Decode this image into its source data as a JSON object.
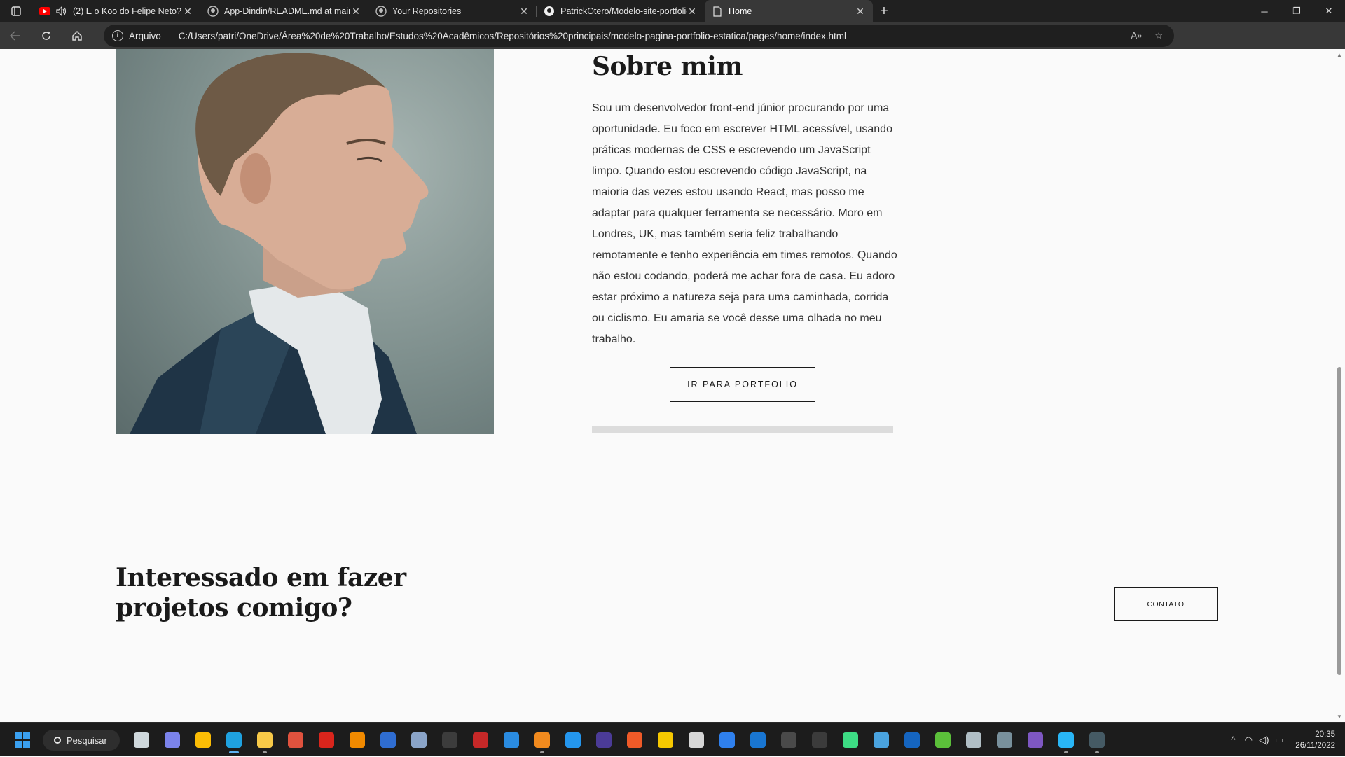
{
  "browser": {
    "tabs": [
      {
        "title": "(2) E o Koo do Felipe Neto?",
        "icon": "youtube-icon",
        "audio": true,
        "active": false
      },
      {
        "title": "App-Dindin/README.md at main",
        "icon": "github-icon",
        "audio": false,
        "active": false
      },
      {
        "title": "Your Repositories",
        "icon": "github-icon",
        "audio": false,
        "active": false
      },
      {
        "title": "PatrickOtero/Modelo-site-portfolio",
        "icon": "github-icon",
        "audio": false,
        "active": false
      },
      {
        "title": "Home",
        "icon": "document-icon",
        "audio": false,
        "active": true
      }
    ],
    "address": {
      "scheme_label": "Arquivo",
      "url": "C:/Users/patri/OneDrive/Área%20de%20Trabalho/Estudos%20Acadêmicos/Repositórios%20principais/modelo-pagina-portfolio-estatica/pages/home/index.html"
    }
  },
  "page": {
    "about": {
      "heading": "Sobre mim",
      "body": "Sou um desenvolvedor front-end júnior procurando por uma oportunidade. Eu foco em escrever HTML acessível, usando práticas modernas de CSS e escrevendo um JavaScript limpo. Quando estou escrevendo código JavaScript, na maioria das vezes estou usando React, mas posso me adaptar para qualquer ferramenta se necessário. Moro em Londres, UK, mas também seria feliz trabalhando remotamente e tenho experiência em times remotos. Quando não estou codando, poderá me achar fora de casa. Eu adoro estar próximo a natureza seja para uma caminhada, corrida ou ciclismo. Eu amaria se você desse uma olhada no meu trabalho.",
      "button_label": "IR PARA PORTFOLIO"
    },
    "cta": {
      "heading": "Interessado em fazer projetos comigo?",
      "button_label": "CONTATO"
    }
  },
  "taskbar": {
    "search_label": "Pesquisar",
    "apps": [
      {
        "name": "task-view-icon",
        "color": "#cfd8dc",
        "running": false
      },
      {
        "name": "meet-icon",
        "color": "#7b83eb",
        "running": false
      },
      {
        "name": "chrome-icon",
        "color": "#fbbc05",
        "running": false
      },
      {
        "name": "edge-icon",
        "color": "#1fa2e0",
        "running": true,
        "active": true
      },
      {
        "name": "file-explorer-icon",
        "color": "#f7c948",
        "running": true
      },
      {
        "name": "creative-cloud-icon",
        "color": "#e0523e",
        "running": false
      },
      {
        "name": "acrobat-icon",
        "color": "#d9251c",
        "running": false
      },
      {
        "name": "vlc-icon",
        "color": "#f18a00",
        "running": false
      },
      {
        "name": "bitwarden-icon",
        "color": "#2f6dd1",
        "running": false
      },
      {
        "name": "notepad-icon",
        "color": "#8aa4c8",
        "running": false
      },
      {
        "name": "terminal-icon",
        "color": "#3c3c3c",
        "running": false
      },
      {
        "name": "devcpp-icon",
        "color": "#c62828",
        "running": false
      },
      {
        "name": "vscode-icon",
        "color": "#2a8be0",
        "running": false
      },
      {
        "name": "sublime-icon",
        "color": "#f18a1e",
        "running": true
      },
      {
        "name": "docker-icon",
        "color": "#2496ed",
        "running": false
      },
      {
        "name": "eclipse-icon",
        "color": "#4b3b97",
        "running": false
      },
      {
        "name": "bookmark-app-icon",
        "color": "#f05a28",
        "running": false
      },
      {
        "name": "beekeeper-icon",
        "color": "#f6c800",
        "running": false
      },
      {
        "name": "search-app-icon",
        "color": "#d6d6d6",
        "running": false
      },
      {
        "name": "browser-app-icon",
        "color": "#2f80ed",
        "running": false
      },
      {
        "name": "insomnia-icon",
        "color": "#1976d2",
        "running": false
      },
      {
        "name": "mm-app-icon",
        "color": "#4a4a4a",
        "running": false
      },
      {
        "name": "iv-app-icon",
        "color": "#3b3b3b",
        "running": false
      },
      {
        "name": "android-app-icon",
        "color": "#3ddc84",
        "running": false
      },
      {
        "name": "dbeaver-icon",
        "color": "#4aa3df",
        "running": false
      },
      {
        "name": "bluetooth-app-icon",
        "color": "#1565c0",
        "running": false
      },
      {
        "name": "utorrent-icon",
        "color": "#5bbf3a",
        "running": false
      },
      {
        "name": "monitor-app-icon",
        "color": "#b0bec5",
        "running": false
      },
      {
        "name": "box-app-icon",
        "color": "#78909c",
        "running": false
      },
      {
        "name": "tor-app-icon",
        "color": "#7e57c2",
        "running": false
      },
      {
        "name": "globe-app-icon",
        "color": "#29b6f6",
        "running": true
      },
      {
        "name": "console-app-icon",
        "color": "#455a64",
        "running": true
      }
    ],
    "clock": {
      "time": "20:35",
      "date": "26/11/2022"
    }
  }
}
